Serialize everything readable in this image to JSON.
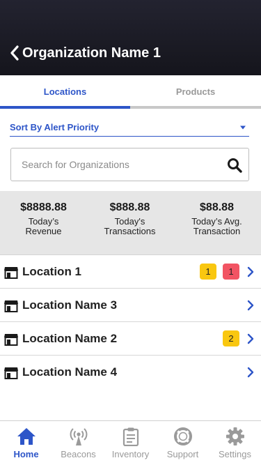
{
  "colors": {
    "accent": "#2d55c8",
    "header_bg": "#1b1b24",
    "badge_yellow": "#f9c710",
    "badge_red": "#f25463",
    "stats_bg": "#e6e6e6",
    "inactive_gray": "#9a9a9a"
  },
  "header": {
    "title": "Organization Name 1",
    "back_icon": "chevron-left-icon"
  },
  "tabs": [
    {
      "label": "Locations",
      "active": true
    },
    {
      "label": "Products",
      "active": false
    }
  ],
  "sort": {
    "label": "Sort By Alert Priority",
    "icon": "caret-down-icon"
  },
  "search": {
    "placeholder": "Search for Organizations",
    "value": "",
    "icon": "search-icon"
  },
  "stats": [
    {
      "value": "$8888.88",
      "label": "Today’s\nRevenue"
    },
    {
      "value": "$888.88",
      "label": "Today's\nTransactions"
    },
    {
      "value": "$88.88",
      "label": "Today’s Avg.\nTransaction"
    }
  ],
  "locations": [
    {
      "name": "Location 1",
      "badges": [
        {
          "count": "1",
          "color": "yellow"
        },
        {
          "count": "1",
          "color": "red"
        }
      ]
    },
    {
      "name": "Location Name 3",
      "badges": []
    },
    {
      "name": "Location Name 2",
      "badges": [
        {
          "count": "2",
          "color": "yellow"
        }
      ]
    },
    {
      "name": "Location Name 4",
      "badges": []
    }
  ],
  "bottom_nav": [
    {
      "label": "Home",
      "icon": "home-icon",
      "active": true
    },
    {
      "label": "Beacons",
      "icon": "antenna-icon",
      "active": false
    },
    {
      "label": "Inventory",
      "icon": "clipboard-icon",
      "active": false
    },
    {
      "label": "Support",
      "icon": "lifebuoy-icon",
      "active": false
    },
    {
      "label": "Settings",
      "icon": "gear-icon",
      "active": false
    }
  ]
}
